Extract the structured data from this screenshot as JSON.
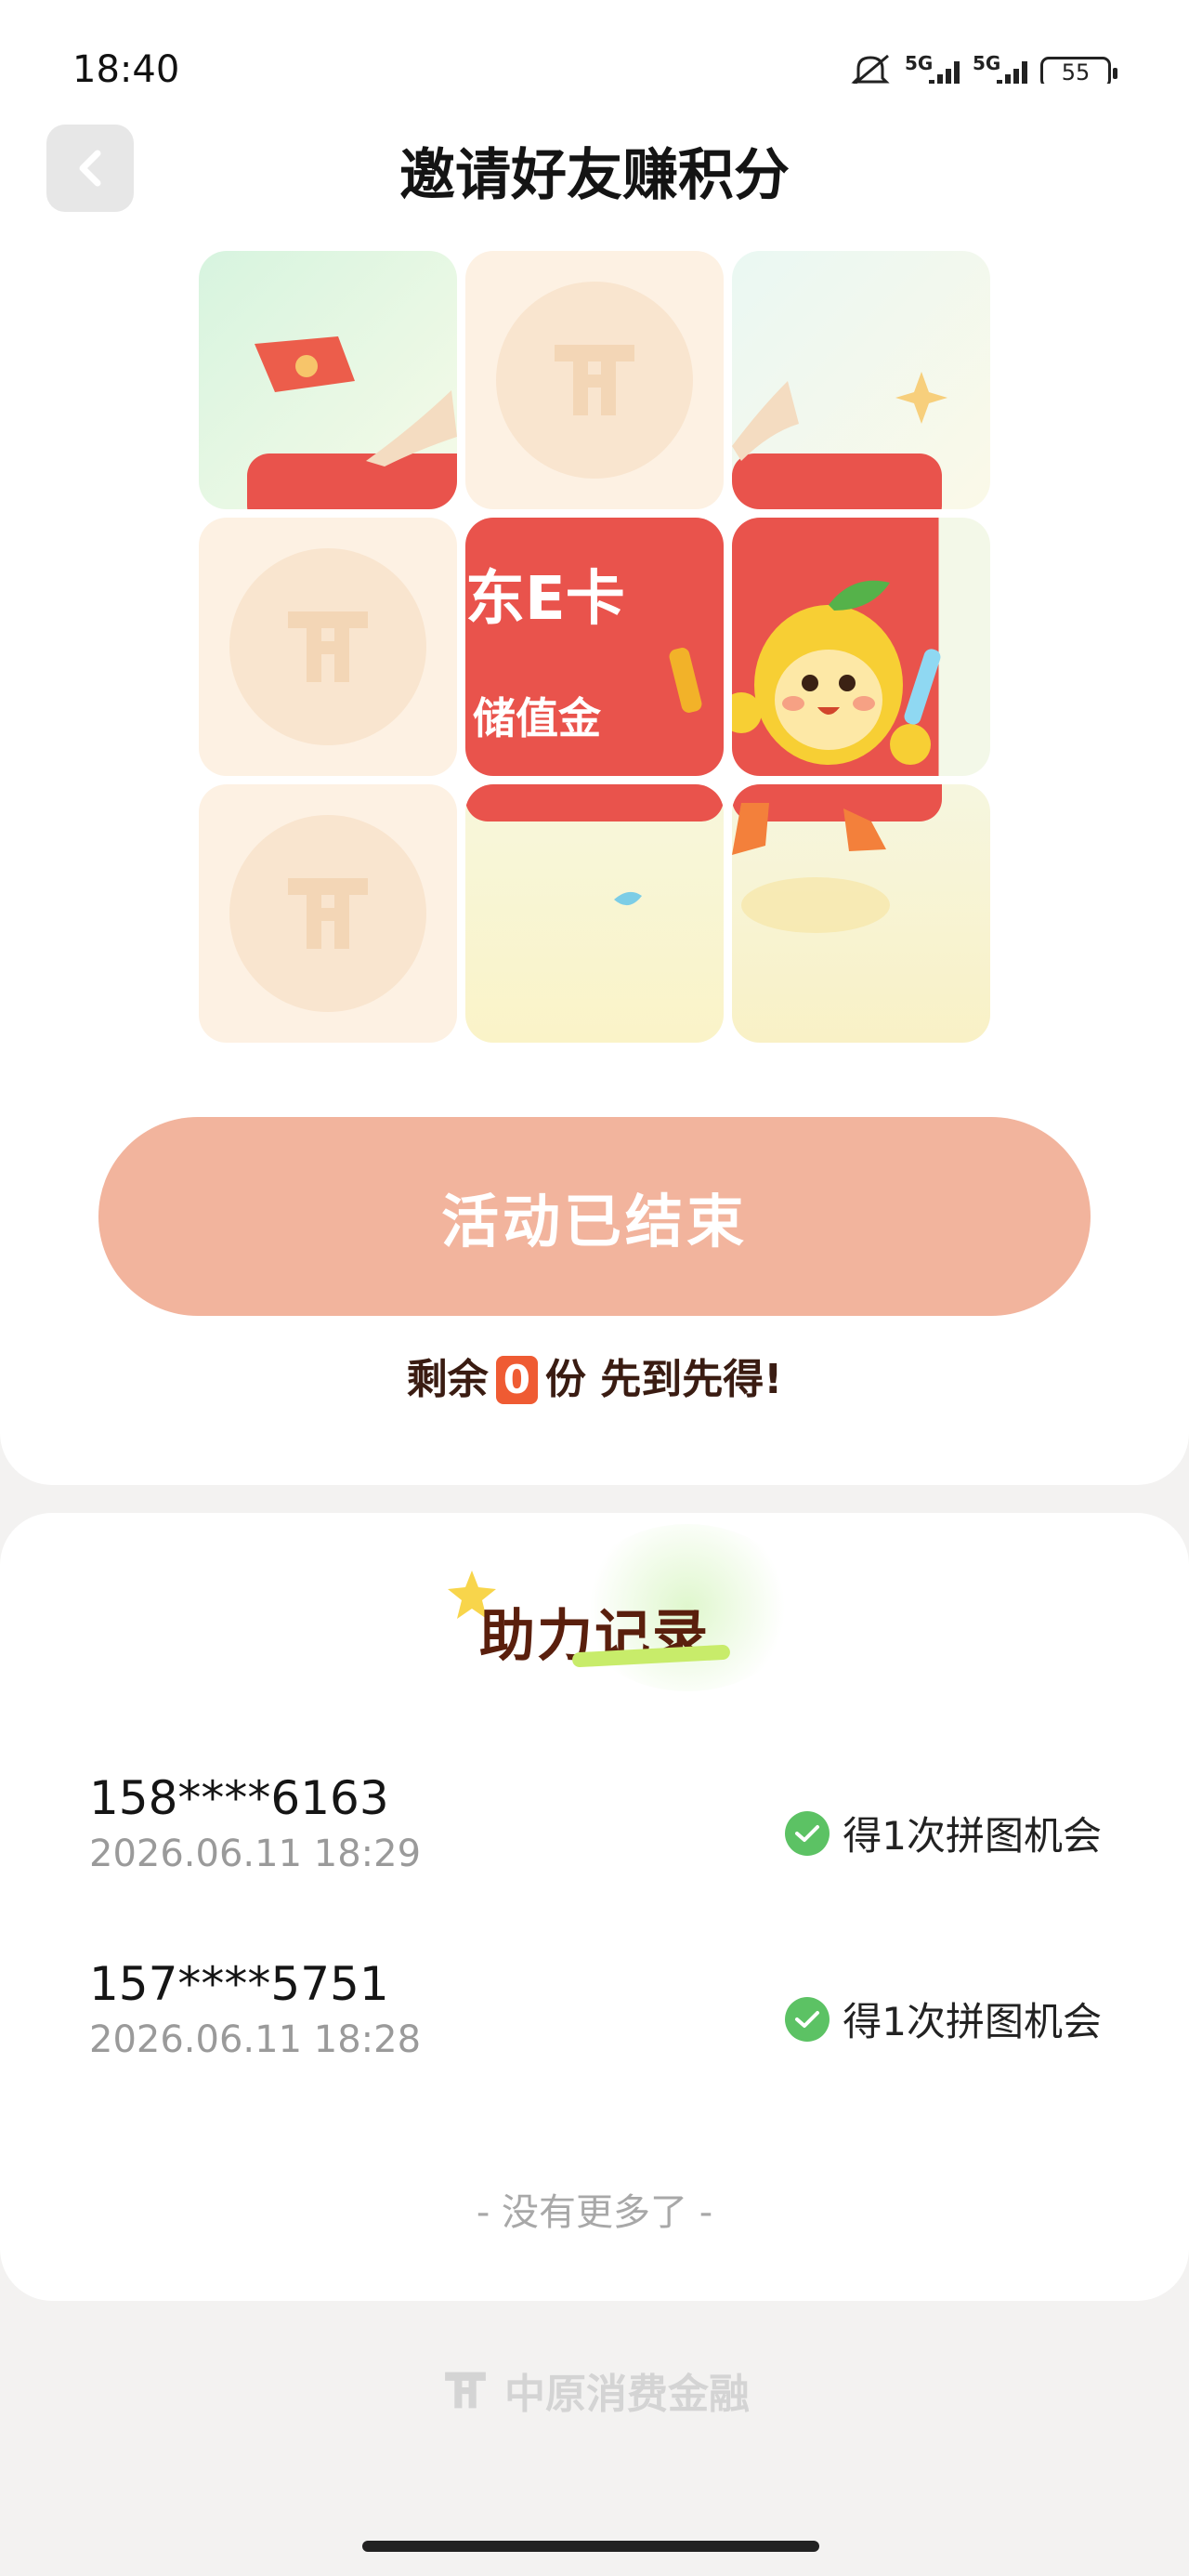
{
  "status_bar": {
    "time": "18:40",
    "network_1": "5G",
    "network_2": "5G",
    "battery": "55",
    "icons": [
      "mute-icon",
      "signal-icon",
      "signal-icon",
      "battery-icon"
    ]
  },
  "header": {
    "title": "邀请好友赚积分",
    "back_icon": "chevron-left-icon"
  },
  "puzzle": {
    "card_title": "东E卡",
    "card_subtitle": "储值金",
    "revealed_pieces": 6,
    "total_pieces": 9
  },
  "activity": {
    "button_label": "活动已结束",
    "remain_prefix": "剩余",
    "remain_count": "0",
    "remain_suffix": "份 先到先得!"
  },
  "records": {
    "title": "助力记录",
    "items": [
      {
        "phone": "158****6163",
        "time": "2026.06.11 18:29",
        "reward": "得1次拼图机会"
      },
      {
        "phone": "157****5751",
        "time": "2026.06.11 18:28",
        "reward": "得1次拼图机会"
      }
    ],
    "no_more": "- 没有更多了 -"
  },
  "footer": {
    "brand": "中原消费金融"
  },
  "colors": {
    "accent_red": "#e9534c",
    "button_disabled": "#f2b49d",
    "count_badge": "#ef5b33",
    "check_green": "#5cc264"
  }
}
